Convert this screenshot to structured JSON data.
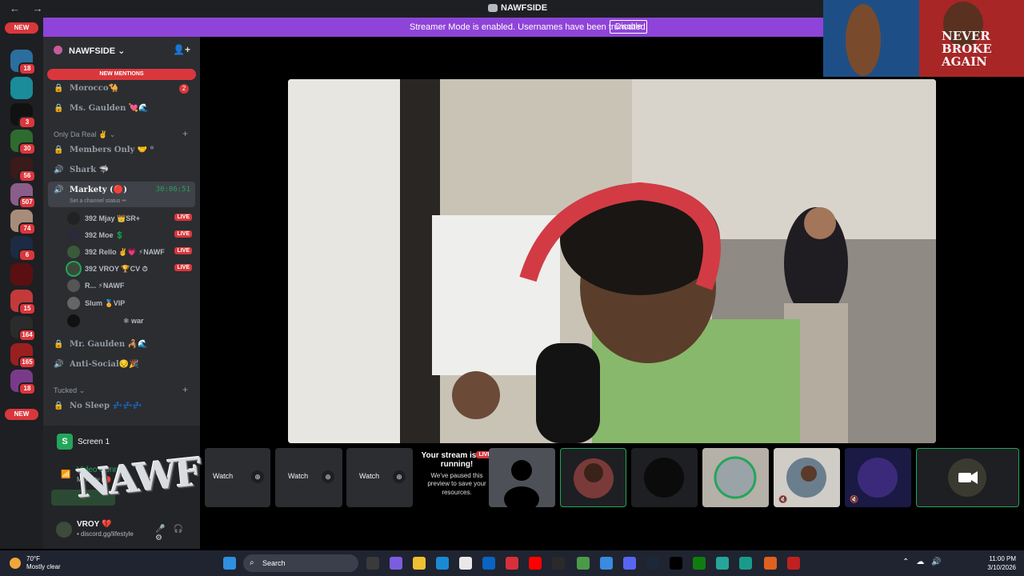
{
  "titlebar": {
    "nav": "← →",
    "app_title": "NAWFSIDE"
  },
  "banner": {
    "message": "Streamer Mode is enabled. Usernames have been truncated.",
    "disable_label": "Disable"
  },
  "rail": {
    "new_top": "NEW",
    "new_bottom": "NEW",
    "badges": [
      "18",
      "3",
      "30",
      "56",
      "507",
      "74",
      "6",
      "15",
      "164",
      "165",
      "18"
    ]
  },
  "guild": {
    "name": "NAWFSIDE",
    "chevron": "⌄",
    "invite_icon": "👤+"
  },
  "new_mentions": "NEW MENTIONS",
  "channels": {
    "morocco": {
      "name": "Morocco🐪",
      "badge": "2"
    },
    "ms_gaulden": {
      "name": "Ms. Gaulden 💘🌊"
    },
    "cat_real": "Only Da Real ✌️ ⌄",
    "members_only": {
      "name": "Members Only 🤝 ⁰"
    },
    "shark": {
      "name": "Shark 🦈"
    },
    "markety": {
      "name": "Markety (🔴)",
      "timer": "30:06:51",
      "status": "Set a channel status ✏"
    },
    "mr_gaulden": {
      "name": "Mr. Gaulden 🦂🌊"
    },
    "anti_social": {
      "name": "Anti-Social😔🎉"
    },
    "cat_tucked": "Tucked ⌄",
    "no_sleep": {
      "name": "No Sleep 💤💤💤"
    }
  },
  "voice_users": [
    {
      "name": "392 Mjay 👑SR+",
      "live": "LIVE"
    },
    {
      "name": "392 Moe 💲",
      "live": "LIVE"
    },
    {
      "name": "392 Rello ✌️💗 ⚡NAWF",
      "live": "LIVE"
    },
    {
      "name": "392 VROY 🏆CV ⏱",
      "live": "LIVE"
    },
    {
      "name": "R... ⚡NAWF",
      "live": ""
    },
    {
      "name": "Slum 🏅VIP",
      "live": ""
    },
    {
      "name": "❄ war",
      "live": ""
    }
  ],
  "panel": {
    "screen_title": "Screen 1",
    "voice_connected": "Video Conn...",
    "voice_channel": "Markety (🔴",
    "username": "VROY 💔",
    "user_status": "• discord.gg/lifestyle"
  },
  "overlay_text": "NAWF",
  "strip": {
    "watch_label": "Watch",
    "paused_title": "Your stream is still running!",
    "paused_desc": "We've paused this preview to save your resources.",
    "live": "LIVE"
  },
  "pip_text": "NEVER BROKE AGAIN",
  "taskbar": {
    "weather_temp": "70°F",
    "weather_desc": "Mostly clear",
    "search": "Search",
    "time": "11:00 PM",
    "date": "3/10/2026"
  },
  "colors": {
    "blurple_banner": "#8e44d8",
    "live_red": "#da373c",
    "voice_green": "#23a55a"
  }
}
